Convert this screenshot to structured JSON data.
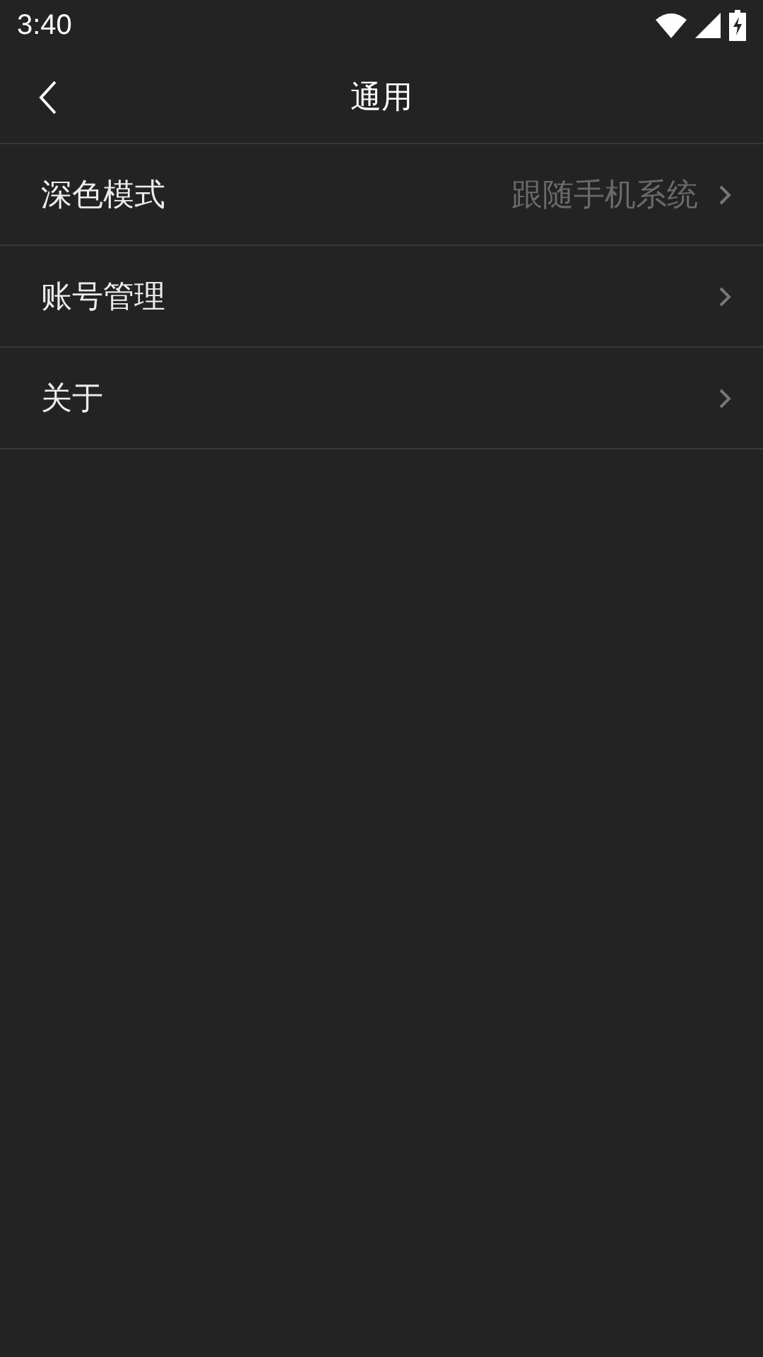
{
  "status_bar": {
    "time": "3:40"
  },
  "header": {
    "title": "通用"
  },
  "rows": [
    {
      "label": "深色模式",
      "value": "跟随手机系统"
    },
    {
      "label": "账号管理"
    },
    {
      "label": "关于"
    }
  ]
}
